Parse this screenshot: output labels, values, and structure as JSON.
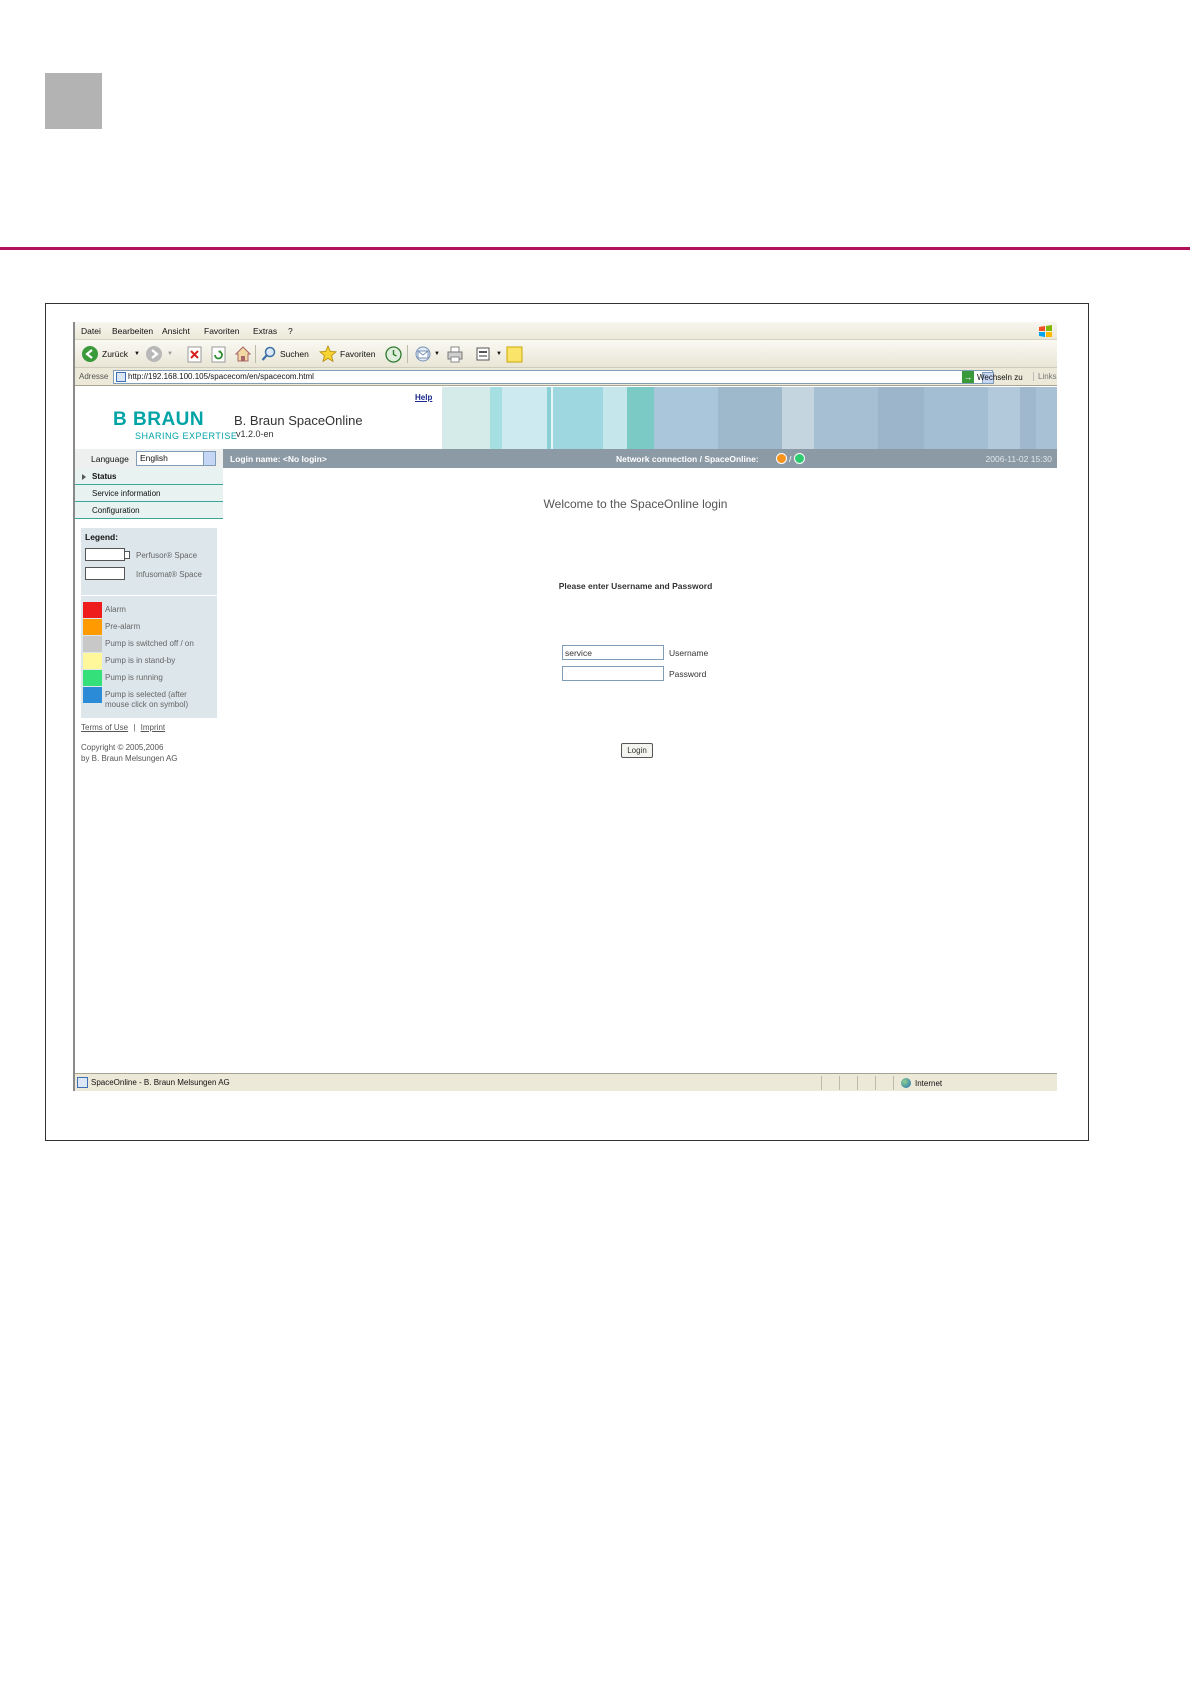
{
  "menu": [
    "Datei",
    "Bearbeiten",
    "Ansicht",
    "Favoriten",
    "Extras",
    "?"
  ],
  "toolbar": {
    "back_label": "Zurück",
    "search_label": "Suchen",
    "favorites_label": "Favoriten"
  },
  "address": {
    "label": "Adresse",
    "url": "http://192.168.100.105/spacecom/en/spacecom.html",
    "go_label": "Wechseln zu",
    "links_label": "Links"
  },
  "header": {
    "logo_word": "B BRAUN",
    "logo_sub": "SHARING EXPERTISE",
    "app_title": "B. Braun SpaceOnline",
    "app_version": "v1.2.0-en",
    "help_label": "Help"
  },
  "language": {
    "label": "Language",
    "selected": "English"
  },
  "info_bar": {
    "login_name": "Login name: <No login>",
    "network_connection": "Network connection / SpaceOnline:",
    "separator": "/",
    "timestamp": "2006-11-02 15:30",
    "led_colors": [
      "#f7941d",
      "#2ecc71"
    ]
  },
  "nav": {
    "status": "Status",
    "service_information": "Service information",
    "configuration": "Configuration"
  },
  "legend": {
    "title": "Legend:",
    "perfusor": "Perfusor® Space",
    "infusomat": "Infusomat® Space",
    "states": [
      {
        "label": "Alarm",
        "color": "#ee1c1c"
      },
      {
        "label": "Pre-alarm",
        "color": "#ff9a00"
      },
      {
        "label": "Pump is switched off / on",
        "color": "#c8c8c8"
      },
      {
        "label": "Pump is in stand-by",
        "color": "#fff799"
      },
      {
        "label": "Pump is running",
        "color": "#33e07a"
      },
      {
        "label": "Pump is selected (after mouse click on symbol)",
        "color": "#2b8bd6"
      }
    ]
  },
  "footer": {
    "terms": "Terms of Use",
    "divider": "|",
    "imprint": "Imprint",
    "copyright_line1": "Copyright © 2005,2006",
    "copyright_line2": "by B. Braun Melsungen AG"
  },
  "login": {
    "welcome": "Welcome to the SpaceOnline login",
    "prompt": "Please enter Username and Password",
    "username_value": "service",
    "username_label": "Username",
    "password_value": "",
    "password_label": "Password",
    "button": "Login"
  },
  "statusbar": {
    "text": "SpaceOnline - B. Braun Melsungen AG",
    "zone": "Internet"
  }
}
